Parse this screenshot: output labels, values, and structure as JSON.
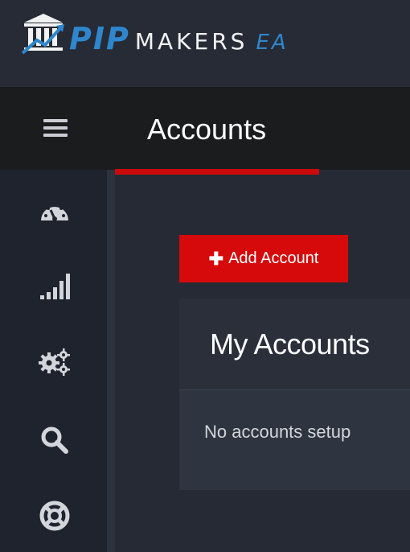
{
  "brand": {
    "logo_pip": "PIP",
    "logo_makers": "MAKERS",
    "logo_ea": "EA",
    "primary_color": "#2f86cc",
    "accent_color": "#d60a0a"
  },
  "header": {
    "title": "Accounts",
    "menu_icon": "hamburger-menu-icon"
  },
  "sidebar": {
    "items": [
      {
        "icon": "dashboard-gauge-icon"
      },
      {
        "icon": "signal-bars-icon"
      },
      {
        "icon": "gears-settings-icon"
      },
      {
        "icon": "search-icon"
      },
      {
        "icon": "support-lifebuoy-icon"
      }
    ]
  },
  "main": {
    "add_button_label": "Add Account",
    "add_button_icon": "plus-icon",
    "card_title": "My Accounts",
    "empty_message": "No accounts setup"
  }
}
